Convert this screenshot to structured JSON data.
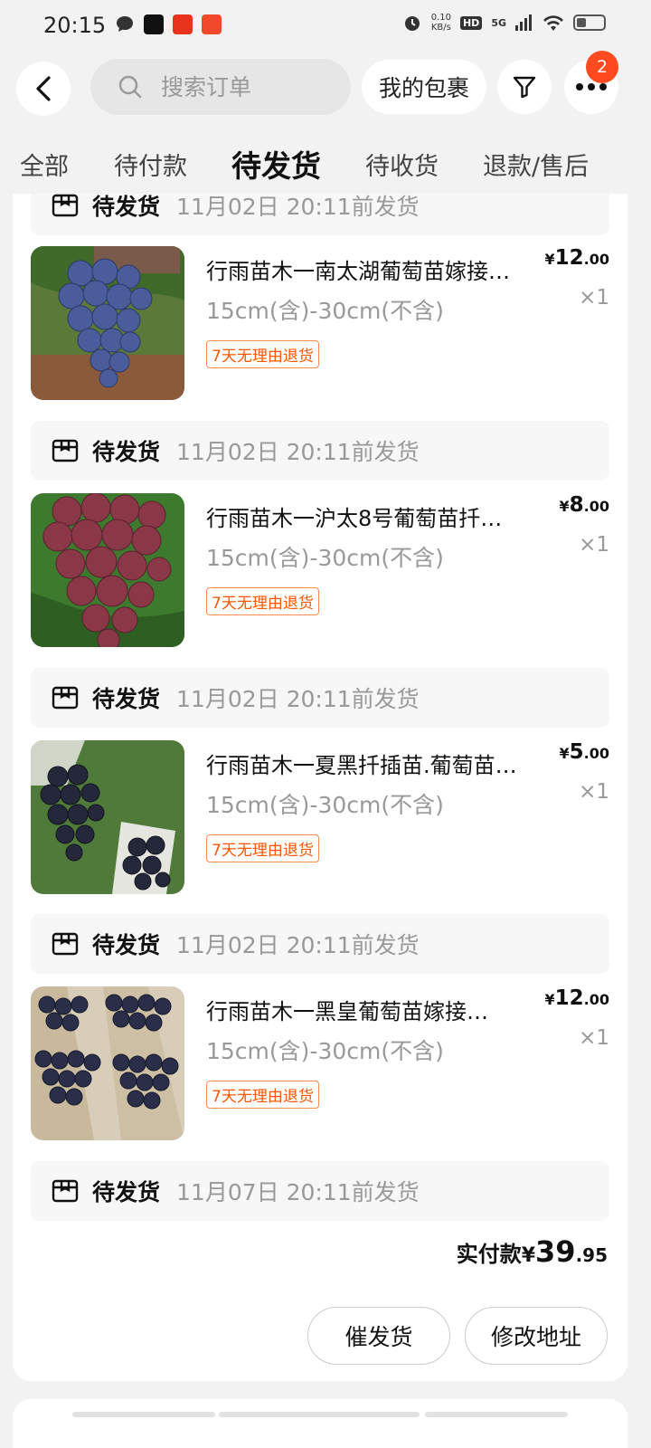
{
  "status_bar": {
    "time": "20:15",
    "net_speed_value": "0.10",
    "net_speed_unit": "KB/s",
    "hd": "HD",
    "network": "5G"
  },
  "topbar": {
    "search_placeholder": "搜索订单",
    "parcel_label": "我的包裹",
    "more_badge": "2"
  },
  "tabs": [
    {
      "label": "全部",
      "active": false
    },
    {
      "label": "待付款",
      "active": false
    },
    {
      "label": "待发货",
      "active": true
    },
    {
      "label": "待收货",
      "active": false
    },
    {
      "label": "退款/售后",
      "active": false
    }
  ],
  "order": {
    "ship_bars": [
      {
        "status": "待发货",
        "deadline": "11月02日 20:11前发货"
      },
      {
        "status": "待发货",
        "deadline": "11月02日 20:11前发货"
      },
      {
        "status": "待发货",
        "deadline": "11月02日 20:11前发货"
      },
      {
        "status": "待发货",
        "deadline": "11月02日 20:11前发货"
      },
      {
        "status": "待发货",
        "deadline": "11月07日 20:11前发货"
      }
    ],
    "items": [
      {
        "title": "行雨苗木一南太湖葡萄苗嫁接…",
        "spec": "15cm(含)-30cm(不含)",
        "tag": "7天无理由退货",
        "price_yen": "¥",
        "price_int": "12",
        "price_dec": ".00",
        "qty": "×1"
      },
      {
        "title": "行雨苗木一沪太8号葡萄苗扦…",
        "spec": "15cm(含)-30cm(不含)",
        "tag": "7天无理由退货",
        "price_yen": "¥",
        "price_int": "8",
        "price_dec": ".00",
        "qty": "×1"
      },
      {
        "title": "行雨苗木一夏黑扦插苗.葡萄苗…",
        "spec": "15cm(含)-30cm(不含)",
        "tag": "7天无理由退货",
        "price_yen": "¥",
        "price_int": "5",
        "price_dec": ".00",
        "qty": "×1"
      },
      {
        "title": "行雨苗木一黑皇葡萄苗嫁接…",
        "spec": "15cm(含)-30cm(不含)",
        "tag": "7天无理由退货",
        "price_yen": "¥",
        "price_int": "12",
        "price_dec": ".00",
        "qty": "×1"
      }
    ],
    "total": {
      "label": "实付款",
      "yen": "¥",
      "int": "39",
      "dec": ".95"
    },
    "buttons": {
      "urge": "催发货",
      "modify_address": "修改地址"
    }
  },
  "colors": {
    "accent": "#ff5500",
    "badge": "#ff4b1f",
    "background": "#f2f2f2"
  }
}
